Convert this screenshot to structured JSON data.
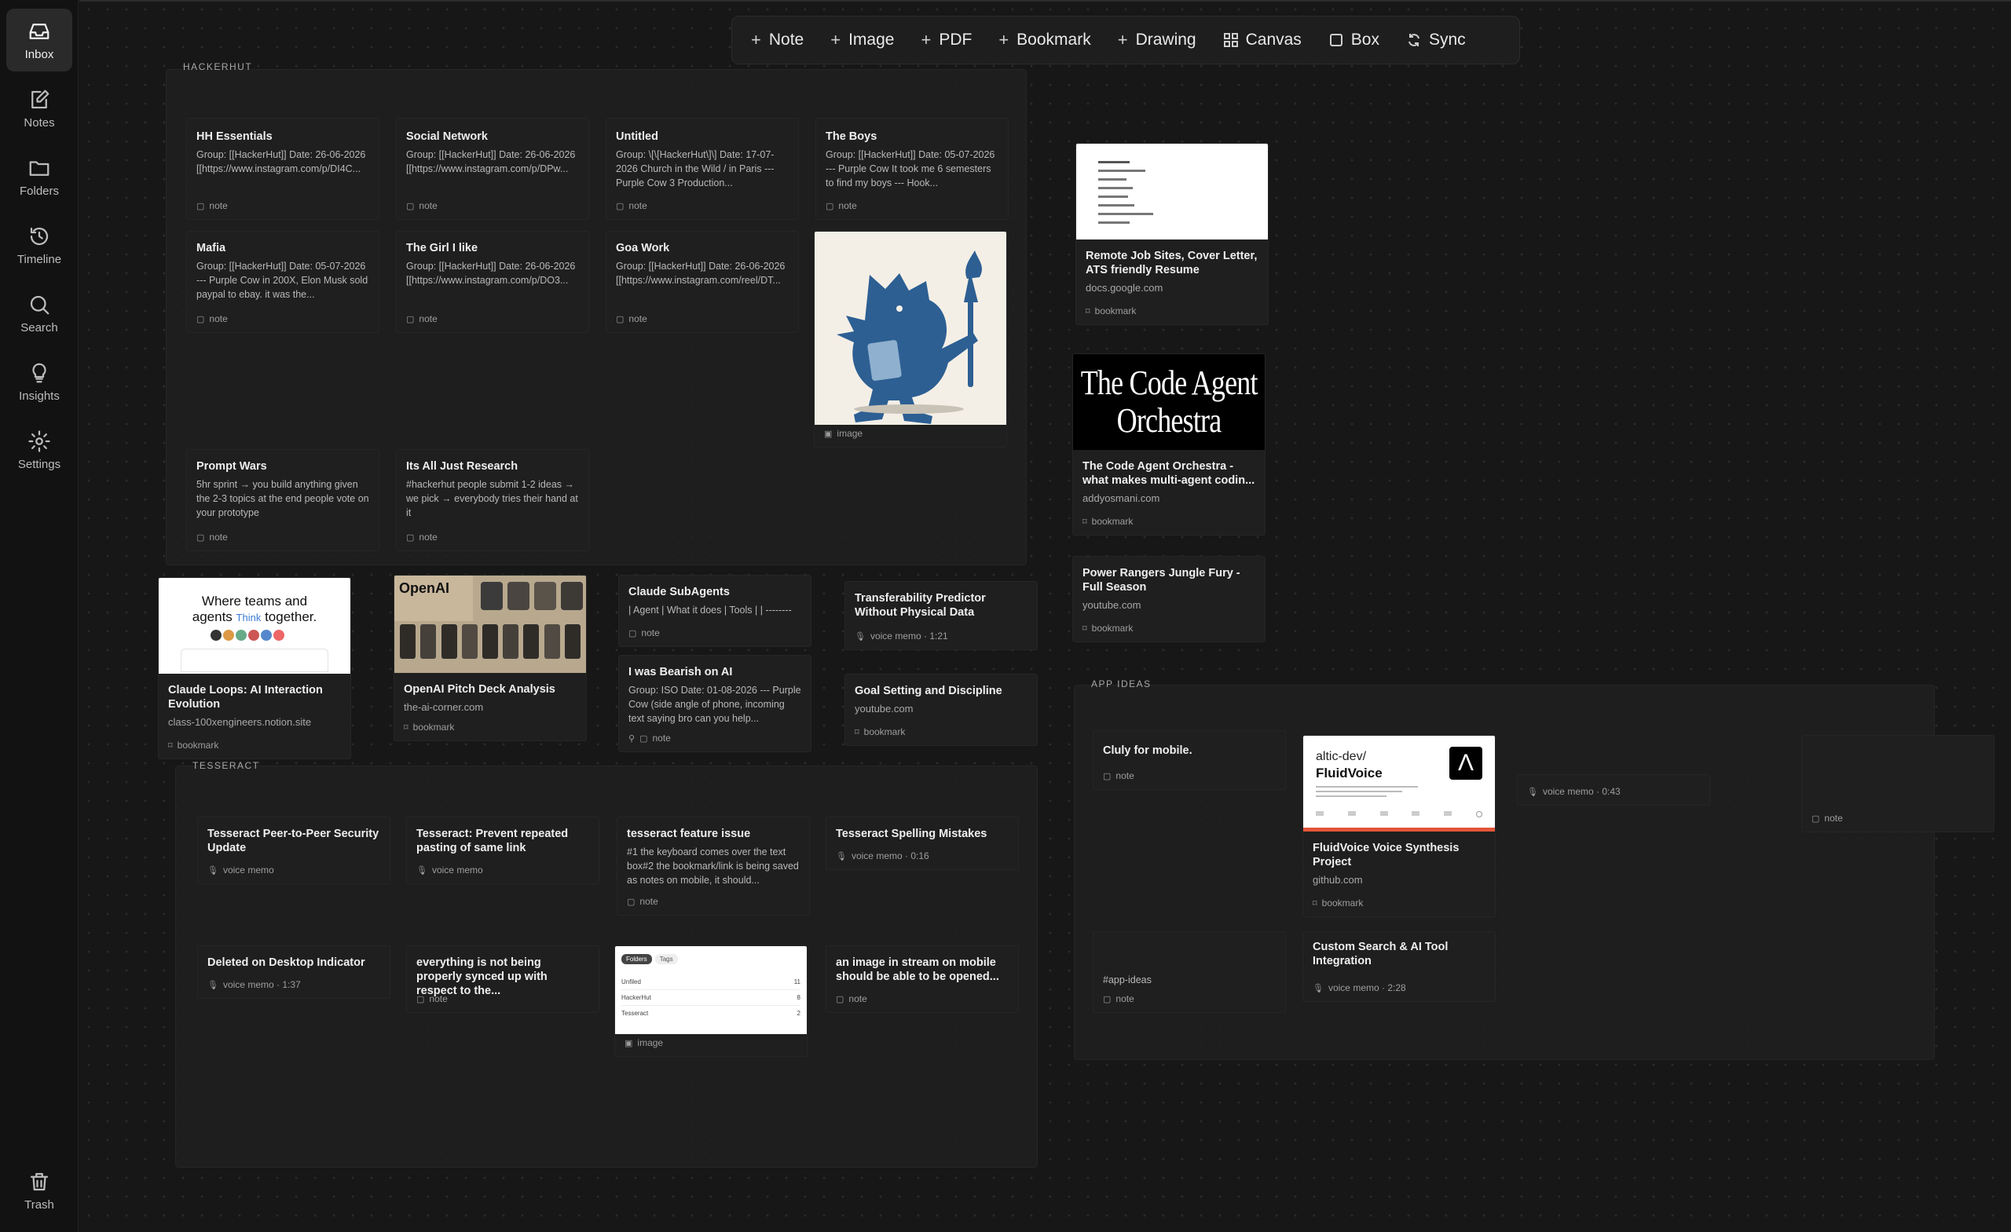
{
  "sidebar": {
    "items": [
      {
        "label": "Inbox",
        "icon": "inbox-icon"
      },
      {
        "label": "Notes",
        "icon": "notes-icon"
      },
      {
        "label": "Folders",
        "icon": "folder-icon"
      },
      {
        "label": "Timeline",
        "icon": "history-icon"
      },
      {
        "label": "Search",
        "icon": "search-icon"
      },
      {
        "label": "Insights",
        "icon": "lightbulb-icon"
      },
      {
        "label": "Settings",
        "icon": "gear-icon"
      }
    ],
    "trash": {
      "label": "Trash",
      "icon": "trash-icon"
    }
  },
  "toolbar": {
    "note": "Note",
    "image": "Image",
    "pdf": "PDF",
    "bookmark": "Bookmark",
    "drawing": "Drawing",
    "canvas": "Canvas",
    "box": "Box",
    "sync": "Sync"
  },
  "groups": {
    "hackerhut": "HACKERHUT",
    "tesseract": "TESSERACT",
    "app_ideas": "APP IDEAS"
  },
  "cards": {
    "hh_essentials": {
      "title": "HH Essentials",
      "body": "Group: [[HackerHut]] Date: 26-06-2026 [[https://www.instagram.com/p/DI4C...",
      "meta": "note"
    },
    "social_network": {
      "title": "Social Network",
      "body": "Group: [[HackerHut]] Date: 26-06-2026 [[https://www.instagram.com/p/DPw...",
      "meta": "note"
    },
    "untitled": {
      "title": "Untitled",
      "body": "Group: \\[\\[HackerHut\\]\\] Date: 17-07-2026 Church in the Wild /            in Paris --- Purple Cow 3 Production...",
      "meta": "note"
    },
    "the_boys": {
      "title": "The Boys",
      "body": "Group: [[HackerHut]] Date: 05-07-2026 --- Purple Cow It took me 6 semesters to find my boys --- Hook...",
      "meta": "note"
    },
    "mafia": {
      "title": "Mafia",
      "body": "Group: [[HackerHut]] Date: 05-07-2026 --- Purple Cow in 200X, Elon Musk sold paypal to ebay. it was the...",
      "meta": "note"
    },
    "girl_i_like": {
      "title": "The Girl I like",
      "body": "Group: [[HackerHut]] Date: 26-06-2026 [[https://www.instagram.com/p/DO3...",
      "meta": "note"
    },
    "goa_work": {
      "title": "Goa Work",
      "body": "Group: [[HackerHut]] Date: 26-06-2026 [[https://www.instagram.com/reel/DT...",
      "meta": "note"
    },
    "mascot_image": {
      "meta": "image"
    },
    "prompt_wars": {
      "title": "Prompt Wars",
      "body": "5hr sprint → you build anything given the 2-3 topics at the end people vote on your prototype",
      "meta": "note"
    },
    "its_all_research": {
      "title": "Its All Just Research",
      "body": "#hackerhut people submit 1-2 ideas → we pick → everybody tries their hand at it",
      "meta": "note"
    },
    "remote_jobs": {
      "title": "Remote Job Sites, Cover Letter, ATS friendly Resume",
      "sub": "docs.google.com",
      "meta": "bookmark"
    },
    "code_agent": {
      "thumb_line1": "The Code Agent",
      "thumb_line2": "Orchestra",
      "title": "The Code Agent Orchestra - what makes multi-agent codin...",
      "sub": "addyosmani.com",
      "meta": "bookmark"
    },
    "power_rangers": {
      "title": "Power Rangers Jungle Fury - Full Season",
      "sub": "youtube.com",
      "meta": "bookmark"
    },
    "claude_loops": {
      "thumb_line1": "Where teams and",
      "thumb_line2a": "agents",
      "thumb_chip": "Think",
      "thumb_line2b": "together.",
      "title": "Claude Loops: AI Interaction Evolution",
      "sub": "class-100xengineers.notion.site",
      "meta": "bookmark"
    },
    "openai_pitch": {
      "thumb_brand": "OpenAI",
      "title": "OpenAI Pitch Deck Analysis",
      "sub": "the-ai-corner.com",
      "meta": "bookmark"
    },
    "claude_subagents": {
      "title": "Claude SubAgents",
      "body": "| Agent | What it does | Tools | | --------",
      "meta": "note"
    },
    "bearish_ai": {
      "title": "I was Bearish on AI",
      "body": "Group: ISO Date: 01-08-2026 --- Purple Cow (side angle of phone, incoming text saying bro can you help...",
      "meta": "note"
    },
    "transferability": {
      "title": "Transferability Predictor Without Physical Data",
      "meta": "voice memo · 1:21"
    },
    "goal_setting": {
      "title": "Goal Setting and Discipline",
      "sub": "youtube.com",
      "meta": "bookmark"
    },
    "tess_p2p": {
      "title": "Tesseract Peer-to-Peer Security Update",
      "meta": "voice memo"
    },
    "tess_prevent": {
      "title": "Tesseract: Prevent repeated pasting of same link",
      "meta": "voice memo"
    },
    "tess_feature": {
      "title": "tesseract feature issue",
      "body": "#1 the keyboard comes over the text box#2 the bookmark/link is being saved as notes on mobile, it should...",
      "meta": "note"
    },
    "tess_spelling": {
      "title": "Tesseract Spelling Mistakes",
      "meta": "voice memo · 0:16"
    },
    "deleted_desktop": {
      "title": "Deleted on Desktop Indicator",
      "meta": "voice memo · 1:37"
    },
    "not_synced": {
      "title": "everything is not being properly synced up with respect to the...",
      "meta": "note"
    },
    "folders_image": {
      "tab1": "Folders",
      "tab2": "Tags",
      "rows": [
        {
          "name": "Unfiled",
          "count": "11"
        },
        {
          "name": "HackerHut",
          "count": "8"
        },
        {
          "name": "Tesseract",
          "count": "2"
        }
      ],
      "meta": "image"
    },
    "image_stream": {
      "title": "an image in stream on mobile should be able to be opened...",
      "meta": "note"
    },
    "cluly": {
      "title": "Cluly for mobile.",
      "meta": "note"
    },
    "fluidvoice": {
      "thumb_repo1": "altic-dev/",
      "thumb_repo2": "FluidVoice",
      "title": "FluidVoice Voice Synthesis Project",
      "sub": "github.com",
      "meta": "bookmark"
    },
    "voice_043": {
      "meta": "voice memo · 0:43"
    },
    "empty_note": {
      "meta": "note"
    },
    "app_ideas_tag": {
      "body": "#app-ideas",
      "meta": "note"
    },
    "custom_search": {
      "title": "Custom Search & AI Tool Integration",
      "meta": "voice memo · 2:28"
    }
  }
}
